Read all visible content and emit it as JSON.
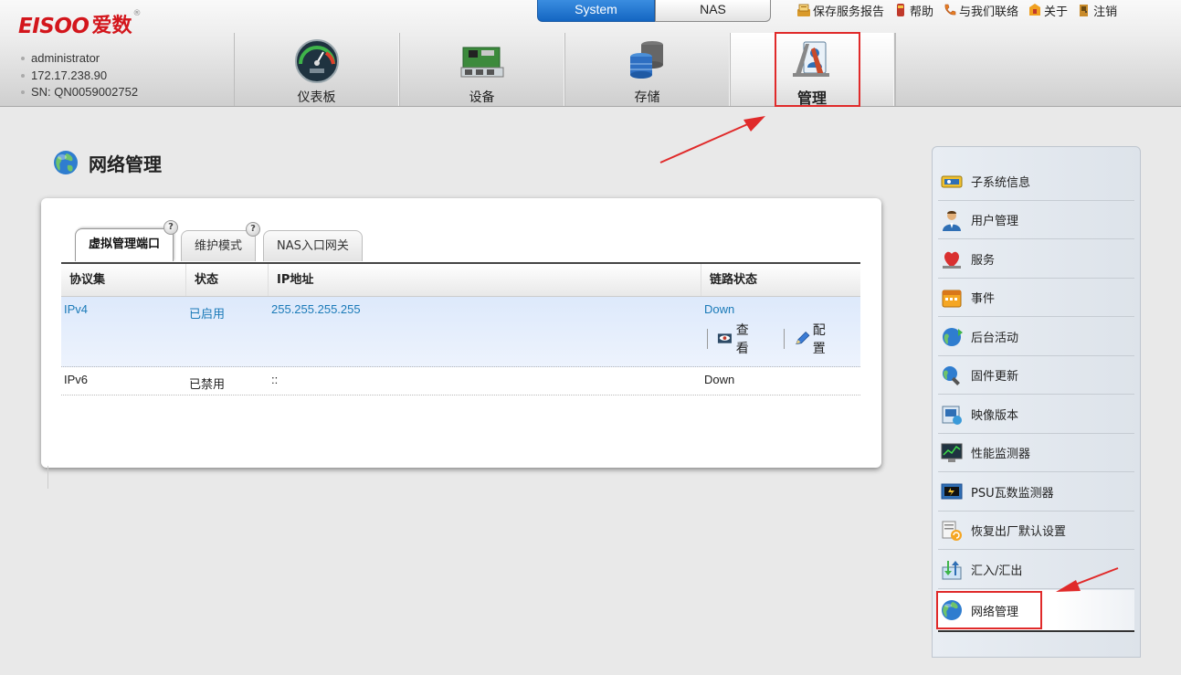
{
  "brand": {
    "name_en": "EISOO",
    "name_cn": "爱数",
    "reg_mark": "®"
  },
  "system_info": [
    "administrator",
    "172.17.238.90",
    "SN: QN0059002752"
  ],
  "mode_switch": {
    "active": "System",
    "inactive": "NAS"
  },
  "top_links": [
    {
      "label": "保存服务报告",
      "icon": "save-report-icon"
    },
    {
      "label": "帮助",
      "icon": "help-icon"
    },
    {
      "label": "与我们联络",
      "icon": "phone-icon"
    },
    {
      "label": "关于",
      "icon": "about-icon"
    },
    {
      "label": "注销",
      "icon": "logout-icon"
    }
  ],
  "nav_tabs": [
    {
      "label": "仪表板",
      "icon": "dashboard-gauge-icon"
    },
    {
      "label": "设备",
      "icon": "device-board-icon"
    },
    {
      "label": "存储",
      "icon": "storage-database-icon"
    },
    {
      "label": "管理",
      "icon": "management-tools-icon",
      "active": true
    }
  ],
  "page": {
    "title": "网络管理",
    "sub_tabs": [
      {
        "label": "虚拟管理端口",
        "active": true,
        "help": "?"
      },
      {
        "label": "维护模式",
        "help": "?"
      },
      {
        "label": "NAS入口网关"
      }
    ],
    "table": {
      "columns": [
        "协议集",
        "状态",
        "IP地址",
        "链路状态"
      ],
      "rows": [
        {
          "protocol": "IPv4",
          "status": "已启用",
          "ip": "255.255.255.255",
          "link": "Down",
          "selected": true
        },
        {
          "protocol": "IPv6",
          "status": "已禁用",
          "ip": "::",
          "link": "Down"
        }
      ],
      "actions": {
        "view": "查看",
        "configure": "配置"
      }
    }
  },
  "side_menu": [
    {
      "label": "子系统信息",
      "icon": "subsystem-info-icon"
    },
    {
      "label": "用户管理",
      "icon": "user-icon"
    },
    {
      "label": "服务",
      "icon": "service-icon"
    },
    {
      "label": "事件",
      "icon": "calendar-event-icon"
    },
    {
      "label": "后台活动",
      "icon": "background-activity-icon"
    },
    {
      "label": "固件更新",
      "icon": "firmware-update-icon"
    },
    {
      "label": "映像版本",
      "icon": "image-version-icon"
    },
    {
      "label": "性能监测器",
      "icon": "performance-monitor-icon"
    },
    {
      "label": "PSU瓦数监测器",
      "icon": "psu-monitor-icon"
    },
    {
      "label": "恢复出厂默认设置",
      "icon": "factory-reset-icon"
    },
    {
      "label": "汇入/汇出",
      "icon": "import-export-icon"
    },
    {
      "label": "网络管理",
      "icon": "network-globe-icon",
      "active": true
    }
  ],
  "colors": {
    "brand_red": "#d3161c",
    "accent_blue": "#1466c2",
    "link_blue": "#1a7ab8",
    "annotation_red": "#e02a2a"
  }
}
